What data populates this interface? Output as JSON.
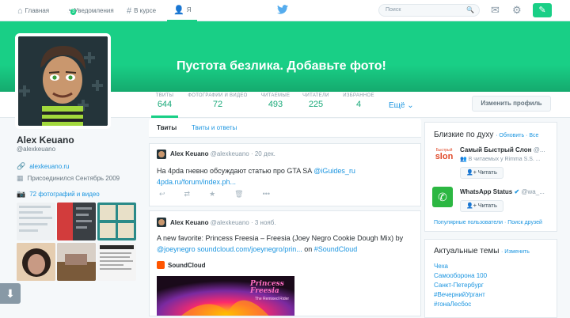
{
  "topbar": {
    "home": "Главная",
    "notifications": "Уведомления",
    "notif_count": "3",
    "discover": "В курсе",
    "me": "Я",
    "search_placeholder": "Поиск"
  },
  "banner": {
    "empty_text": "Пустота безлика. Добавьте фото!"
  },
  "stats": [
    {
      "label": "ТВИТЫ",
      "value": "644"
    },
    {
      "label": "ФОТОГРАФИИ И ВИДЕО",
      "value": "72"
    },
    {
      "label": "ЧИТАЕМЫЕ",
      "value": "493"
    },
    {
      "label": "ЧИТАТЕЛИ",
      "value": "225"
    },
    {
      "label": "ИЗБРАННОЕ",
      "value": "4"
    }
  ],
  "more": "Ещё",
  "edit_profile": "Изменить профиль",
  "profile": {
    "name": "Alex Keuano",
    "handle": "@alexkeuano",
    "website": "alexkeuano.ru",
    "joined": "Присоединился Сентябрь 2009",
    "media": "72 фотографий и видео"
  },
  "tabs": {
    "tweets": "Твиты",
    "replies": "Твиты и ответы"
  },
  "tweets": [
    {
      "name": "Alex Keuano",
      "meta": "@alexkeuano · 20 дек.",
      "line1a": "На 4pda гневно обсуждают статью про GTA SA ",
      "line1b": "@iGuides_ru",
      "line2": "4pda.ru/forum/index.ph..."
    },
    {
      "name": "Alex Keuano",
      "meta": "@alexkeuano · 3 нояб.",
      "line1": "A new favorite: Princess Freesia – Freesia (Joey Negro Cookie Dough Mix) by",
      "line2a": "@joeynegro soundcloud.com/joeynegro/prin...",
      "line2b": " on ",
      "line2c": "#SoundCloud",
      "source": "SoundCloud",
      "art_title": "Princess Freesia",
      "art_sub": "The Remixed Rider"
    }
  ],
  "wtf": {
    "title": "Близкие по духу",
    "refresh": "· Обновить · Все",
    "users": [
      {
        "name": "Самый Быстрый Слон",
        "handle": "@...",
        "sub": "В читаемых у Rimma S.S. ...",
        "follow": "Читать",
        "logo_top": "Быстрый",
        "logo_main": "slon"
      },
      {
        "name": "WhatsApp Status",
        "handle": "@wa_...",
        "follow": "Читать"
      }
    ],
    "footer": "Популярные пользователи · Поиск друзей"
  },
  "trends": {
    "title": "Актуальные темы",
    "change": "· Изменить",
    "items": [
      "Чеха",
      "Самооборона 100",
      "Санкт-Петербург",
      "#ВечернийУргант",
      "#гонаЛесбос"
    ]
  },
  "colors": {
    "accent": "#19cf86",
    "link": "#1b95e0",
    "banner": "#19cf86"
  }
}
